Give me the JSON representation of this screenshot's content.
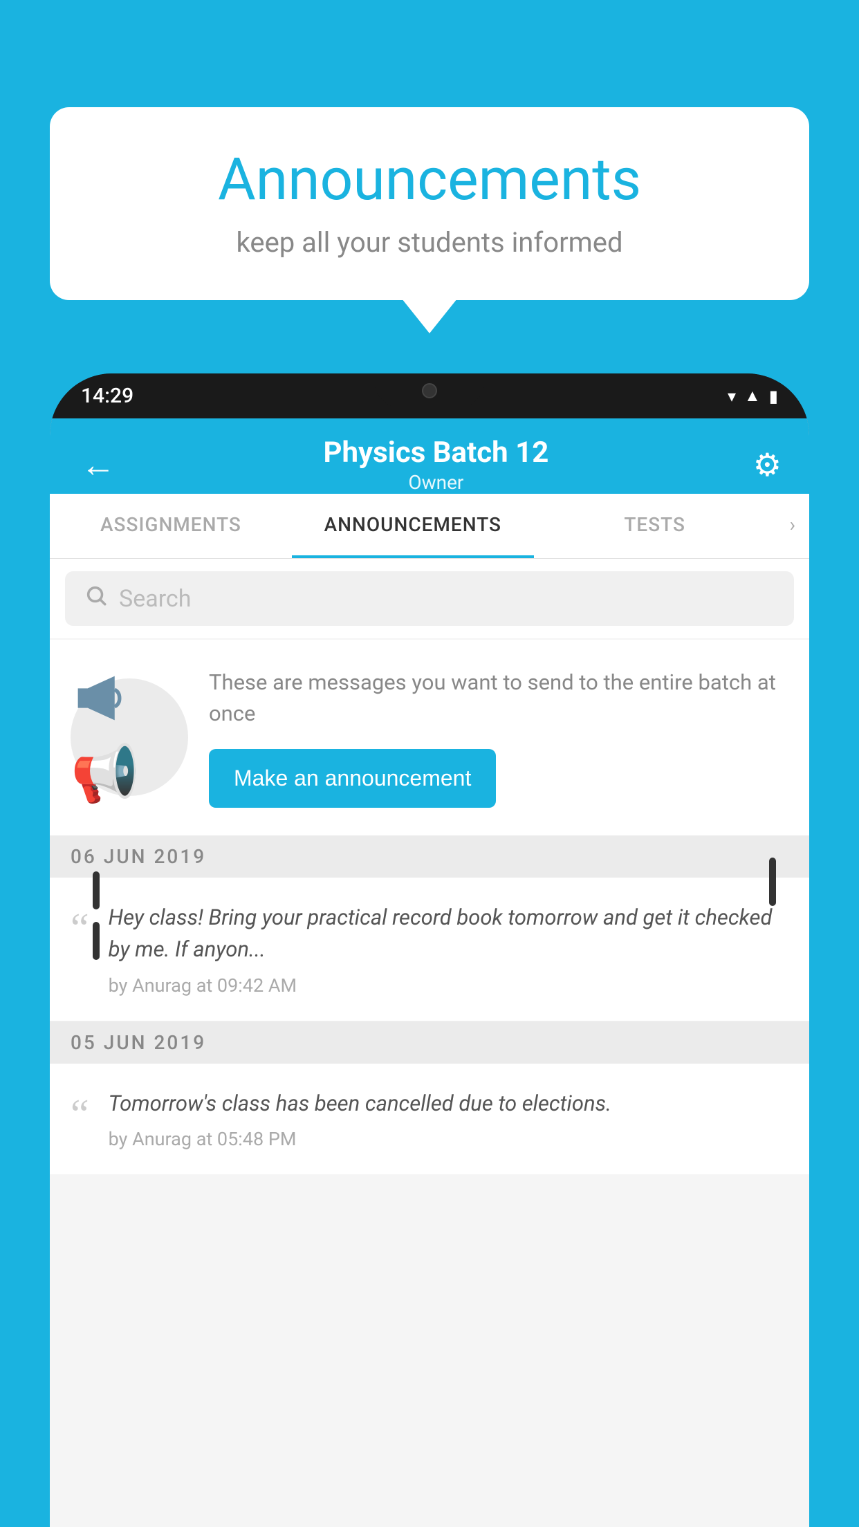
{
  "background_color": "#1ab3e0",
  "speech_bubble": {
    "title": "Announcements",
    "subtitle": "keep all your students informed"
  },
  "phone": {
    "status_bar": {
      "time": "14:29"
    },
    "header": {
      "title": "Physics Batch 12",
      "subtitle": "Owner",
      "back_label": "←",
      "settings_label": "⚙"
    },
    "tabs": [
      {
        "label": "ASSIGNMENTS",
        "active": false
      },
      {
        "label": "ANNOUNCEMENTS",
        "active": true
      },
      {
        "label": "TESTS",
        "active": false
      }
    ],
    "search": {
      "placeholder": "Search"
    },
    "announcement_prompt": {
      "description": "These are messages you want to send to the entire batch at once",
      "button_label": "Make an announcement"
    },
    "announcement_groups": [
      {
        "date": "06  JUN  2019",
        "items": [
          {
            "text": "Hey class! Bring your practical record book tomorrow and get it checked by me. If anyon...",
            "author": "by Anurag at 09:42 AM"
          }
        ]
      },
      {
        "date": "05  JUN  2019",
        "items": [
          {
            "text": "Tomorrow's class has been cancelled due to elections.",
            "author": "by Anurag at 05:48 PM"
          }
        ]
      }
    ]
  }
}
